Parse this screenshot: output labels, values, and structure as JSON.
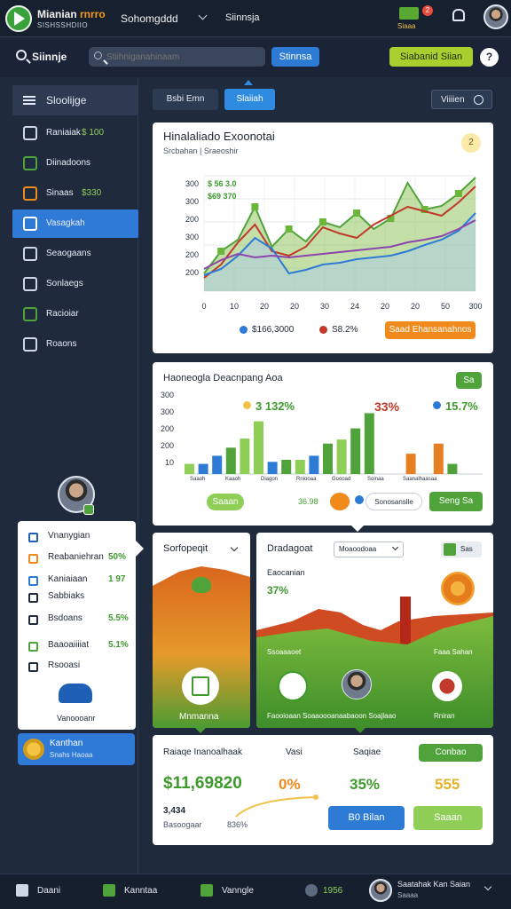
{
  "topbar": {
    "brand_line1_a": "Mianian",
    "brand_line1_b": "rnrro",
    "brand_line2": "SISHSSHDIIO",
    "nav1": "Sohomgddd",
    "nav2": "Siinnsja",
    "cart_label": "Siaaa",
    "badge_count": "2"
  },
  "search_row": {
    "title": "Siinnje",
    "search_placeholder": "Stiihniganahinaam",
    "blue_button": "Stinnsa",
    "lime_button": "Siabanid Siian"
  },
  "sidebar": {
    "header": "Sloolijge",
    "items": [
      {
        "label": "Raniaiak",
        "value": "$ 100",
        "icon": "tag-icon"
      },
      {
        "label": "Diinadoons",
        "icon": "check-circle-icon"
      },
      {
        "label": "Sinaas",
        "value": "$330",
        "icon": "box-icon"
      },
      {
        "label": "Vasagkah",
        "icon": "user-icon",
        "active": true
      },
      {
        "label": "Seaogaans",
        "icon": "refresh-icon"
      },
      {
        "label": "Sonlaegs",
        "icon": "bookmark-icon"
      },
      {
        "label": "Racioiar",
        "icon": "puzzle-icon"
      },
      {
        "label": "Roaons",
        "icon": "rocket-icon"
      }
    ]
  },
  "toolbar": {
    "tab1": "Bsbi Emn",
    "tab2": "Slaiiah",
    "view_label": "Viiiien"
  },
  "line_card": {
    "title": "Hinalaliado Exoonotai",
    "subtitle": "Srcbahan | Sraeoshir",
    "badge": "2",
    "annotation1": "$ 56 3.0",
    "annotation2": "$69 370",
    "legend1": "$166,3000",
    "legend2": "S8.2%",
    "orange_button": "Saad Ehansanahnos"
  },
  "bar_card": {
    "title": "Haoneogla Deacnpang Aoa",
    "kpi1": "3 132%",
    "kpi2": "33%",
    "kpi3": "15.7%",
    "pill_button": "Saaan",
    "stat1": "36.98",
    "chip": "Sonosanslle",
    "green_button": "Seng Sa",
    "corner_button": "Sa"
  },
  "popup": {
    "items": [
      {
        "label": "Vnanygian",
        "value": ""
      },
      {
        "label": "Reabaniehran",
        "value": "50%"
      },
      {
        "label": "Kaniaiaan",
        "value": "1 97"
      },
      {
        "label": "Sabbiaks",
        "value": ""
      },
      {
        "label": "Bsdoans",
        "value": "5.5%"
      },
      {
        "label": "Baaoaiiiiat",
        "value": "5.1%"
      },
      {
        "label": "Rsooasi",
        "value": ""
      }
    ],
    "footer": "Vanoooanr"
  },
  "user_chip": {
    "name": "Kanthan",
    "sub": "Snahs Haoaa"
  },
  "orange_card": {
    "title": "Sorfopeqit",
    "footer": "Mnmanna"
  },
  "green_card": {
    "title": "Dradagoat",
    "dropdown": "Moaoodoaa",
    "corner_btn": "Sas",
    "sub": "Eaocanian",
    "pct": "37%",
    "left_lbl": "Ssoaaaoet",
    "right_lbl": "Faaa Sahan",
    "footer": "Faooioaan Soaaoooanaabaoon Soajlaao",
    "foot_right": "Rniran"
  },
  "summary_card": {
    "h1": "Raiaqe Inanoalhaak",
    "h2": "Vasi",
    "h3": "Saqiae",
    "dropdown": "Conbao",
    "big_value": "$11,69820",
    "pct1": "0%",
    "pct2": "35%",
    "pct3": "555",
    "small1": "3,434",
    "small2": "Basoogaar",
    "small3": "836%",
    "btn_blue": "B0 Bilan",
    "btn_green": "Saaan"
  },
  "bottombar": {
    "items": [
      "Daani",
      "Kanntaa",
      "Vanngle",
      "1956"
    ],
    "user": "Saatahak Kan Saian",
    "user_sub": "Saaaa"
  },
  "chart_data": [
    {
      "type": "line",
      "title": "Hinalaliado Exoonotai",
      "xlabel": "",
      "ylabel": "",
      "x_ticks": [
        "0",
        "10",
        "20",
        "20",
        "30",
        "24",
        "20",
        "20",
        "50",
        "300"
      ],
      "y_ticks": [
        "300",
        "300",
        "200",
        "300",
        "200",
        "200"
      ],
      "series": [
        {
          "color": "#4fa33a",
          "values": [
            20,
            45,
            58,
            95,
            50,
            70,
            56,
            78,
            72,
            88,
            70,
            82,
            122,
            92,
            96,
            110,
            128
          ]
        },
        {
          "color": "#c0392b",
          "values": [
            15,
            30,
            55,
            75,
            45,
            40,
            50,
            72,
            65,
            60,
            75,
            85,
            95,
            90,
            85,
            100,
            118
          ]
        },
        {
          "color": "#2e7bd6",
          "values": [
            18,
            25,
            40,
            60,
            48,
            20,
            24,
            30,
            32,
            36,
            38,
            40,
            45,
            52,
            58,
            68,
            88
          ]
        },
        {
          "color": "#8e44ad",
          "values": [
            25,
            35,
            42,
            38,
            40,
            38,
            40,
            42,
            44,
            46,
            48,
            50,
            55,
            58,
            62,
            70,
            80
          ]
        }
      ]
    },
    {
      "type": "bar",
      "title": "Haoneogla Deacnpang Aoa",
      "y_ticks": [
        "300",
        "300",
        "200",
        "200",
        "10"
      ],
      "series": [
        {
          "name": "group",
          "values": [
            10,
            10,
            18,
            26,
            35,
            52,
            12,
            14,
            14,
            18,
            30,
            34,
            45,
            60,
            0,
            0,
            20,
            0,
            30,
            10
          ]
        }
      ],
      "colors": [
        "#8fcf58",
        "#2e7bd6",
        "#2e7bd6",
        "#4fa33a",
        "#8fcf58",
        "#8fcf58",
        "#2e7bd6",
        "#4fa33a",
        "#8fcf58",
        "#2e7bd6",
        "#4fa33a",
        "#8fcf58",
        "#4fa33a",
        "#4fa33a",
        "#fff",
        "#fff",
        "#e67e22",
        "#fff",
        "#e67e22",
        "#4fa33a"
      ]
    }
  ]
}
